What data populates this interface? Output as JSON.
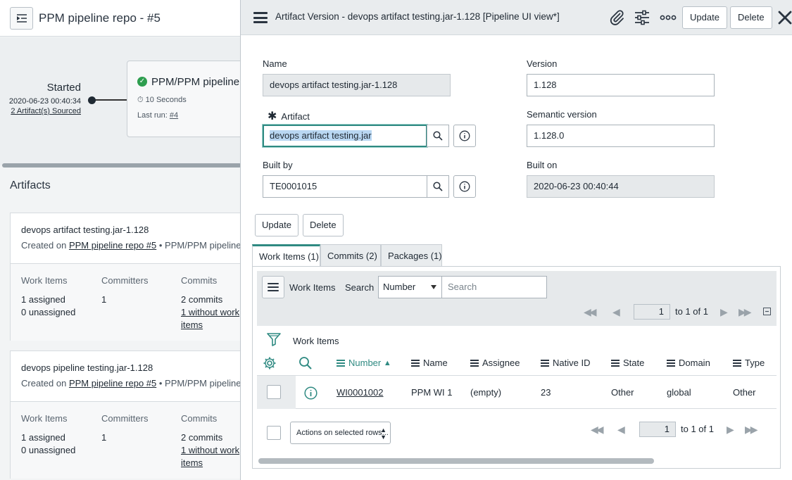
{
  "background": {
    "title": "PPM pipeline repo - #5",
    "started": {
      "label": "Started",
      "date": "2020-06-23 00:40:34",
      "artifacts_link": "2 Artifact(s) Sourced"
    },
    "stage": {
      "title": "PPM/PPM pipeline re",
      "duration": "10 Seconds",
      "last_run_label": "Last run:",
      "last_run_link": "#4"
    },
    "section_title": "Artifacts",
    "artifacts": [
      {
        "title": "devops artifact testing.jar-1.128",
        "created_prefix": "Created on",
        "created_link": "PPM pipeline repo #5",
        "created_suffix": "• PPM/PPM pipeline rep",
        "work_items_label": "Work Items",
        "work_items_assigned": "1 assigned",
        "work_items_unassigned": "0 unassigned",
        "committers_label": "Committers",
        "committers_value": "1",
        "commits_label": "Commits",
        "commits_value": "2 commits",
        "commits_without_1": "1 without work",
        "commits_without_2": "items"
      },
      {
        "title": "devops pipeline testing.jar-1.128",
        "created_prefix": "Created on",
        "created_link": "PPM pipeline repo #5",
        "created_suffix": "• PPM/PPM pipeline rep",
        "work_items_label": "Work Items",
        "work_items_assigned": "1 assigned",
        "work_items_unassigned": "0 unassigned",
        "committers_label": "Committers",
        "committers_value": "1",
        "commits_label": "Commits",
        "commits_value": "2 commits",
        "commits_without_1": "1 without work",
        "commits_without_2": "items"
      }
    ]
  },
  "modal": {
    "title": "Artifact Version - devops artifact testing.jar-1.128 [Pipeline UI view*]",
    "header_buttons": {
      "update": "Update",
      "delete": "Delete"
    },
    "icons": [
      "menu-icon",
      "paperclip-icon",
      "sliders-icon",
      "more-icon",
      "close-icon"
    ],
    "form": {
      "name_label": "Name",
      "name_value": "devops artifact testing.jar-1.128",
      "artifact_label": "Artifact",
      "artifact_required": "✱",
      "artifact_value": "devops artifact testing.jar",
      "built_by_label": "Built by",
      "built_by_value": "TE0001015",
      "version_label": "Version",
      "version_value": "1.128",
      "semantic_label": "Semantic version",
      "semantic_value": "1.128.0",
      "built_on_label": "Built on",
      "built_on_value": "2020-06-23 00:40:44"
    },
    "actions": {
      "update": "Update",
      "delete": "Delete"
    },
    "tabs": [
      {
        "label": "Work Items (1)",
        "active": true
      },
      {
        "label": "Commits (2)",
        "active": false
      },
      {
        "label": "Packages (1)",
        "active": false
      }
    ],
    "related_list": {
      "title": "Work Items",
      "search_label": "Search",
      "search_field": "Number",
      "search_placeholder": "Search",
      "pager": {
        "page": "1",
        "of_text": "to 1 of 1"
      },
      "filter_label": "Work Items",
      "columns": [
        "Number",
        "Name",
        "Assignee",
        "Native ID",
        "State",
        "Domain",
        "Type"
      ],
      "sort_indicator": "▲",
      "rows": [
        {
          "number": "WI0001002",
          "name": "PPM WI 1",
          "assignee": "(empty)",
          "native_id": "23",
          "state": "Other",
          "domain": "global",
          "type": "Other"
        }
      ],
      "actions_select": "Actions on selected rows...",
      "bottom_pager": {
        "page": "1",
        "of_text": "to 1 of 1"
      }
    },
    "accent_color": "#2f8a82"
  }
}
